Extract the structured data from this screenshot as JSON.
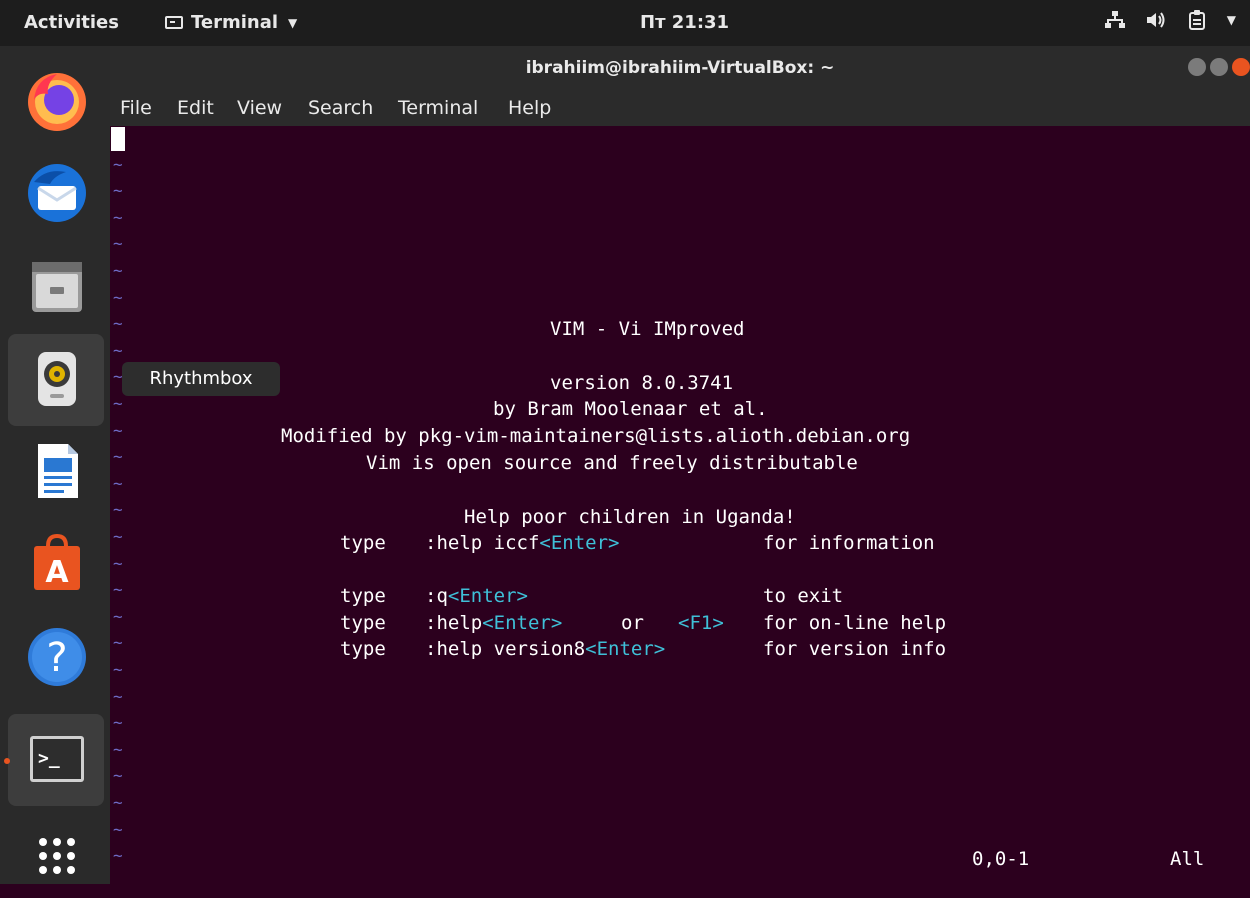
{
  "topbar": {
    "activities": "Activities",
    "app_name": "Terminal",
    "clock": "Пт 21:31"
  },
  "dock": {
    "items": [
      "Firefox",
      "Thunderbird",
      "Files",
      "Rhythmbox",
      "LibreOffice Writer",
      "Ubuntu Software",
      "Help",
      "Terminal",
      "Show Applications"
    ],
    "tooltip": "Rhythmbox"
  },
  "window": {
    "title": "ibrahiim@ibrahiim-VirtualBox: ~",
    "menu": [
      "File",
      "Edit",
      "View",
      "Search",
      "Terminal",
      "Help"
    ]
  },
  "vim": {
    "title": "VIM - Vi IMproved",
    "version": "version 8.0.3741",
    "author": "by Bram Moolenaar et al.",
    "modified": "Modified by pkg-vim-maintainers@lists.alioth.debian.org",
    "license": "Vim is open source and freely distributable",
    "charity": "Help poor children in Uganda!",
    "type_word": "type",
    "cmd_iccf": ":help iccf",
    "enter": "<Enter>",
    "desc_iccf": "for information",
    "cmd_q": ":q",
    "desc_q": "to exit",
    "cmd_help": ":help",
    "or_word": "or",
    "f1": "<F1>",
    "desc_help": "for on-line help",
    "cmd_ver": ":help version8",
    "desc_ver": "for version info",
    "status_pos": "0,0-1",
    "status_all": "All"
  },
  "colors": {
    "terminal_bg": "#2c001e",
    "tilde": "#6f6cc8",
    "special_key": "#3fc0d8",
    "ubuntu_orange": "#e95420"
  }
}
